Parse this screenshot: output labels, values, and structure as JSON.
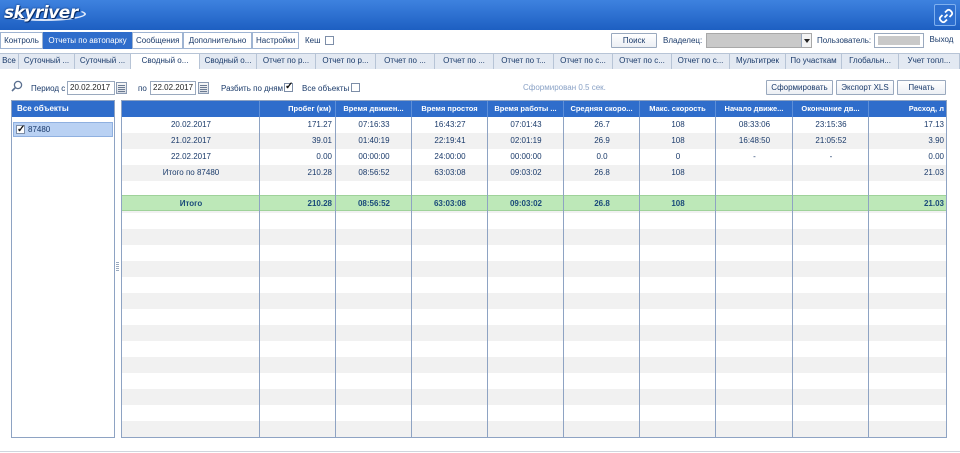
{
  "header": {
    "logo": "skyriver"
  },
  "menu": {
    "tabs": [
      {
        "label": "Контроль",
        "active": false
      },
      {
        "label": "Отчеты по автопарку",
        "active": true
      },
      {
        "label": "Сообщения",
        "active": false
      },
      {
        "label": "Дополнительно",
        "active": false
      },
      {
        "label": "Настройки",
        "active": false
      }
    ],
    "cache_label": "Кеш",
    "search_button": "Поиск",
    "owner_label": "Владелец:",
    "user_label": "Пользователь:",
    "exit_button": "Выход"
  },
  "report_tabs": [
    "Все",
    "Суточный ...",
    "Суточный ...",
    "Сводный о...",
    "Сводный о...",
    "Отчет по р...",
    "Отчет по р...",
    "Отчет по ...",
    "Отчет по ...",
    "Отчет по т...",
    "Отчет по с...",
    "Отчет по с...",
    "Отчет по с...",
    "Мультитрек",
    "По участкам",
    "Глобальн...",
    "Учет топл..."
  ],
  "active_report_tab": 3,
  "toolbar": {
    "period_from_label": "Период с",
    "date_from": "20.02.2017",
    "period_to_label": "по",
    "date_to": "22.02.2017",
    "split_by_days_label": "Разбить по дням",
    "split_by_days_checked": true,
    "all_objects_label": "Все объекты",
    "all_objects_checked": false,
    "status": "Сформирован 0.5 сек.",
    "generate_button": "Сформировать",
    "export_button": "Экспорт XLS",
    "print_button": "Печать"
  },
  "left_panel": {
    "title": "Все объекты",
    "items": [
      {
        "label": "87480",
        "checked": true
      }
    ]
  },
  "grid": {
    "columns": [
      "",
      "Пробег (км)",
      "Время движен...",
      "Время простоя",
      "Время работы ...",
      "Средняя скоро...",
      "Макс. скорость",
      "Начало движе...",
      "Окончание дв...",
      "Расход, л"
    ],
    "rows": [
      [
        "20.02.2017",
        "171.27",
        "07:16:33",
        "16:43:27",
        "07:01:43",
        "26.7",
        "108",
        "08:33:06",
        "23:15:36",
        "17.13"
      ],
      [
        "21.02.2017",
        "39.01",
        "01:40:19",
        "22:19:41",
        "02:01:19",
        "26.9",
        "108",
        "16:48:50",
        "21:05:52",
        "3.90"
      ],
      [
        "22.02.2017",
        "0.00",
        "00:00:00",
        "24:00:00",
        "00:00:00",
        "0.0",
        "0",
        "-",
        "-",
        "0.00"
      ],
      [
        "Итого по 87480",
        "210.28",
        "08:56:52",
        "63:03:08",
        "09:03:02",
        "26.8",
        "108",
        "",
        "",
        "21.03"
      ]
    ],
    "total_row": [
      "Итого",
      "210.28",
      "08:56:52",
      "63:03:08",
      "09:03:02",
      "26.8",
      "108",
      "",
      "",
      "21.03"
    ]
  },
  "colors": {
    "header_blue": "#2f6dcb",
    "total_green": "#bde8b8"
  }
}
